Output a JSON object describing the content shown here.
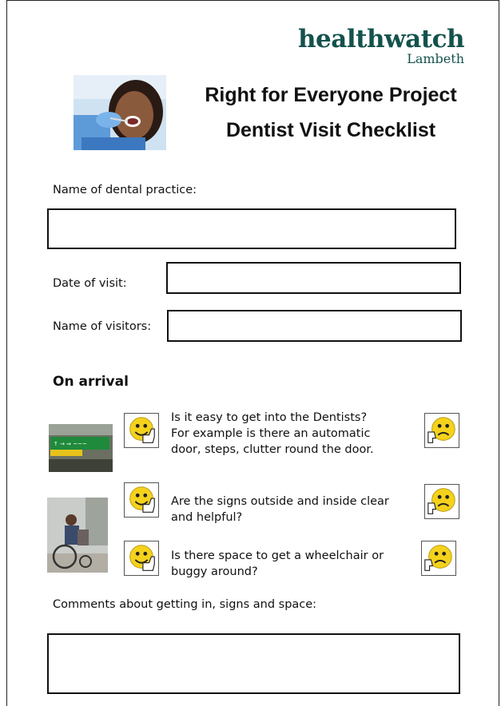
{
  "logo": {
    "main": "healthwatch",
    "sub": "Lambeth"
  },
  "title": {
    "line1": "Right for Everyone Project",
    "line2": "Dentist Visit Checklist"
  },
  "form": {
    "practice_label": "Name of dental practice:",
    "date_label": "Date of visit:",
    "visitors_label": "Name of visitors:"
  },
  "section_heading": "On arrival",
  "questions": [
    {
      "text_lines": [
        "Is it easy to get into the Dentists?",
        "For example is there an automatic",
        "door, steps, clutter round the door."
      ]
    },
    {
      "text_lines": [
        "Are the signs outside and inside clear",
        "and helpful?"
      ]
    },
    {
      "text_lines": [
        "Is there space to get a wheelchair or",
        "buggy around?"
      ]
    }
  ],
  "comments_label": "Comments about getting in, signs and space:",
  "colors": {
    "brand": "#14524d",
    "accent_dot": "#b4237a",
    "smiley": "#f4d21c"
  },
  "icons": {
    "happy": "thumbs-up-smiley-icon",
    "unhappy": "thumbs-down-frown-icon"
  }
}
